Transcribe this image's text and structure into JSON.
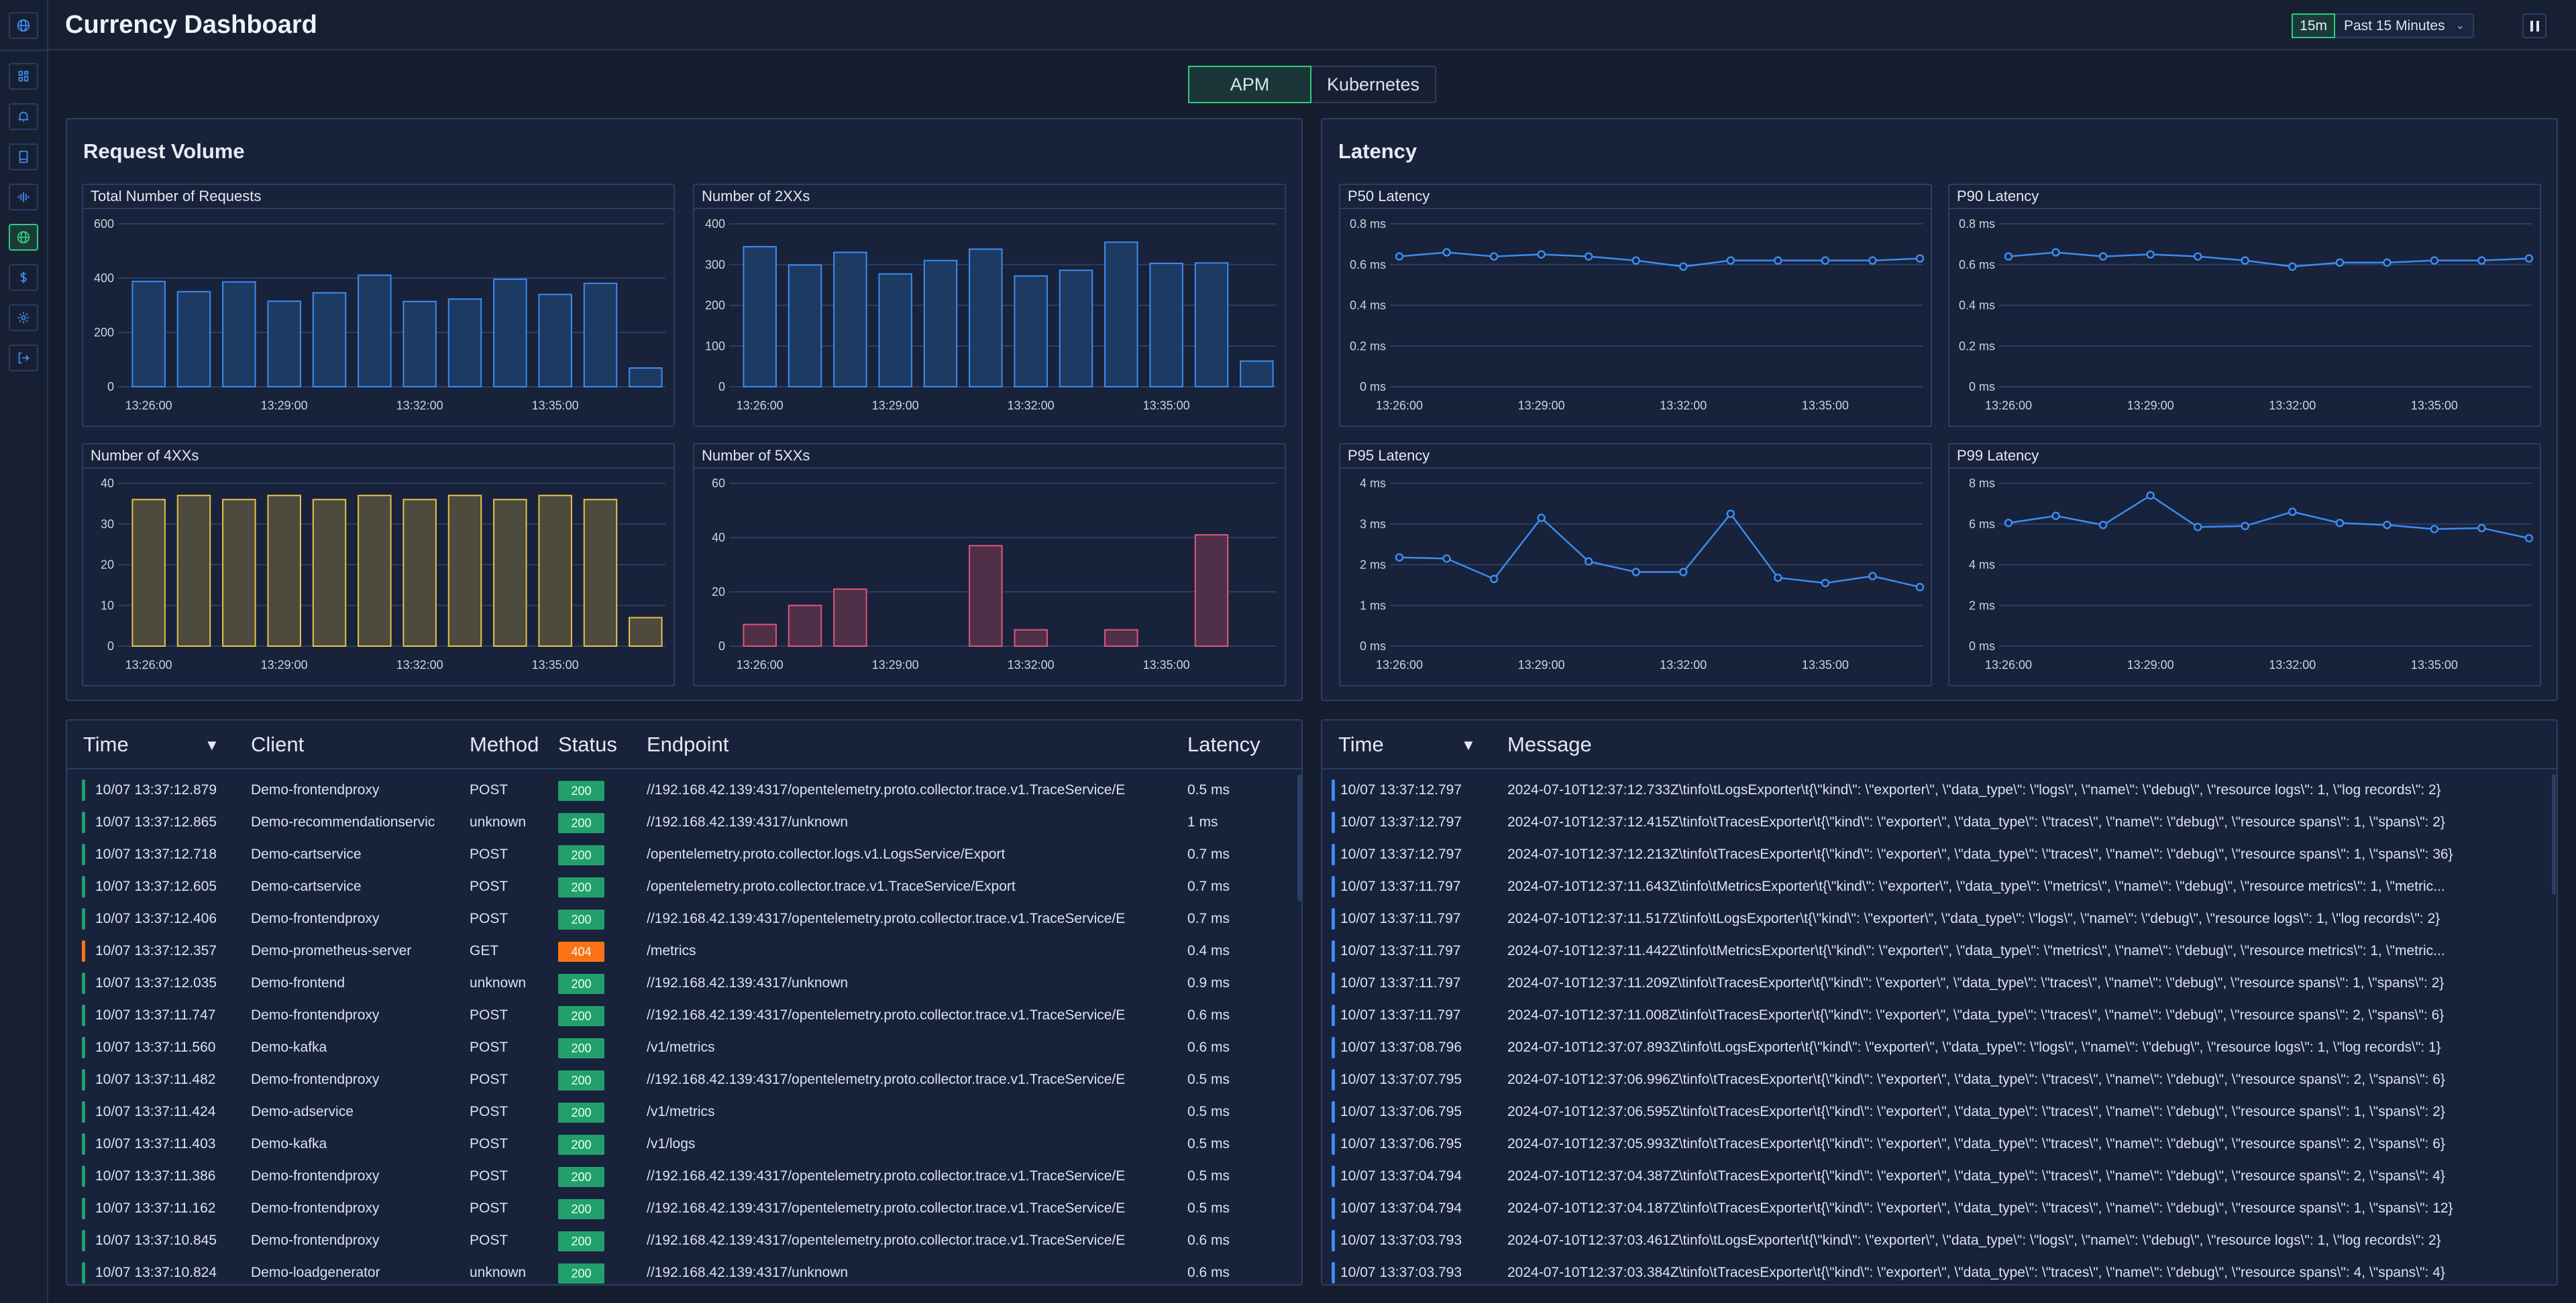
{
  "header": {
    "title": "Currency Dashboard",
    "range_short": "15m",
    "range_label": "Past 15 Minutes"
  },
  "sidebar": {
    "items": [
      {
        "icon": "globe-icon"
      },
      {
        "icon": "dashboard-grid-icon"
      },
      {
        "icon": "bell-icon"
      },
      {
        "icon": "book-icon"
      },
      {
        "icon": "waveform-icon"
      },
      {
        "icon": "globe-icon",
        "active": true
      },
      {
        "icon": "dollar-icon"
      },
      {
        "icon": "gear-icon"
      },
      {
        "icon": "logout-icon"
      }
    ]
  },
  "tabs": [
    {
      "label": "APM",
      "active": true
    },
    {
      "label": "Kubernetes",
      "active": false
    }
  ],
  "panels": {
    "request_volume": "Request Volume",
    "latency": "Latency"
  },
  "colors": {
    "accent": "#2ecc7a",
    "blue": "#3b8cf0",
    "yellow": "#e8c24a",
    "pink": "#e0557a",
    "ok": "#22a06b",
    "warn": "#f97316"
  },
  "chart_data": [
    {
      "type": "bar",
      "title": "Total Number of Requests",
      "color": "#3b8cf0",
      "fill": "#1d3a63",
      "x": [
        "13:26:00",
        "13:27:00",
        "13:28:00",
        "13:29:00",
        "13:30:00",
        "13:31:00",
        "13:32:00",
        "13:33:00",
        "13:34:00",
        "13:35:00",
        "13:36:00",
        "13:37:00"
      ],
      "x_ticks": [
        "13:26:00",
        "13:29:00",
        "13:32:00",
        "13:35:00"
      ],
      "values": [
        388,
        350,
        386,
        315,
        346,
        411,
        314,
        323,
        396,
        340,
        381,
        69
      ],
      "ylim": [
        0,
        600
      ],
      "y_ticks": [
        "0",
        "200",
        "400",
        "600"
      ],
      "grid": true
    },
    {
      "type": "bar",
      "title": "Number of 2XXs",
      "color": "#3b8cf0",
      "fill": "#1d3a63",
      "x": [
        "13:26:00",
        "13:27:00",
        "13:28:00",
        "13:29:00",
        "13:30:00",
        "13:31:00",
        "13:32:00",
        "13:33:00",
        "13:34:00",
        "13:35:00",
        "13:36:00",
        "13:37:00"
      ],
      "x_ticks": [
        "13:26:00",
        "13:29:00",
        "13:32:00",
        "13:35:00"
      ],
      "values": [
        344,
        299,
        330,
        277,
        310,
        338,
        272,
        286,
        355,
        303,
        304,
        63
      ],
      "ylim": [
        0,
        400
      ],
      "y_ticks": [
        "0",
        "100",
        "200",
        "300",
        "400"
      ],
      "grid": true
    },
    {
      "type": "bar",
      "title": "Number of 4XXs",
      "color": "#e8c24a",
      "fill": "#4d4a3e",
      "x": [
        "13:26:00",
        "13:27:00",
        "13:28:00",
        "13:29:00",
        "13:30:00",
        "13:31:00",
        "13:32:00",
        "13:33:00",
        "13:34:00",
        "13:35:00",
        "13:36:00",
        "13:37:00"
      ],
      "x_ticks": [
        "13:26:00",
        "13:29:00",
        "13:32:00",
        "13:35:00"
      ],
      "values": [
        36,
        37,
        36,
        37,
        36,
        37,
        36,
        37,
        36,
        37,
        36,
        7
      ],
      "ylim": [
        0,
        40
      ],
      "y_ticks": [
        "0",
        "10",
        "20",
        "30",
        "40"
      ],
      "grid": true
    },
    {
      "type": "bar",
      "title": "Number of 5XXs",
      "color": "#e0557a",
      "fill": "#4f3048",
      "x": [
        "13:26:00",
        "13:27:00",
        "13:28:00",
        "13:29:00",
        "13:30:00",
        "13:31:00",
        "13:32:00",
        "13:33:00",
        "13:34:00",
        "13:35:00",
        "13:36:00",
        "13:37:00"
      ],
      "x_ticks": [
        "13:26:00",
        "13:29:00",
        "13:32:00",
        "13:35:00"
      ],
      "values": [
        8,
        15,
        21,
        0,
        0,
        37,
        6,
        0,
        6,
        0,
        41,
        0
      ],
      "ylim": [
        0,
        60
      ],
      "y_ticks": [
        "0",
        "20",
        "40",
        "60"
      ],
      "grid": true
    },
    {
      "type": "line",
      "title": "P50 Latency",
      "color": "#3b8cf0",
      "x": [
        "13:26:00",
        "13:27:00",
        "13:28:00",
        "13:29:00",
        "13:30:00",
        "13:31:00",
        "13:32:00",
        "13:33:00",
        "13:34:00",
        "13:35:00",
        "13:36:00",
        "13:37:00"
      ],
      "x_ticks": [
        "13:26:00",
        "13:29:00",
        "13:32:00",
        "13:35:00"
      ],
      "values": [
        0.64,
        0.66,
        0.64,
        0.65,
        0.64,
        0.62,
        0.59,
        0.62,
        0.62,
        0.62,
        0.62,
        0.63
      ],
      "ylim": [
        0,
        0.8
      ],
      "y_ticks": [
        "0 ms",
        "0.2 ms",
        "0.4 ms",
        "0.6 ms",
        "0.8 ms"
      ],
      "unit": "ms",
      "grid": true
    },
    {
      "type": "line",
      "title": "P90 Latency",
      "color": "#3b8cf0",
      "x": [
        "13:26:00",
        "13:27:00",
        "13:28:00",
        "13:29:00",
        "13:30:00",
        "13:31:00",
        "13:32:00",
        "13:33:00",
        "13:34:00",
        "13:35:00",
        "13:36:00",
        "13:37:00"
      ],
      "x_ticks": [
        "13:26:00",
        "13:29:00",
        "13:32:00",
        "13:35:00"
      ],
      "values": [
        0.64,
        0.66,
        0.64,
        0.65,
        0.64,
        0.62,
        0.59,
        0.61,
        0.61,
        0.62,
        0.62,
        0.63
      ],
      "ylim": [
        0,
        0.8
      ],
      "y_ticks": [
        "0 ms",
        "0.2 ms",
        "0.4 ms",
        "0.6 ms",
        "0.8 ms"
      ],
      "unit": "ms",
      "grid": true
    },
    {
      "type": "line",
      "title": "P95 Latency",
      "color": "#3b8cf0",
      "x": [
        "13:26:00",
        "13:27:00",
        "13:28:00",
        "13:29:00",
        "13:30:00",
        "13:31:00",
        "13:32:00",
        "13:33:00",
        "13:34:00",
        "13:35:00",
        "13:36:00",
        "13:37:00"
      ],
      "x_ticks": [
        "13:26:00",
        "13:29:00",
        "13:32:00",
        "13:35:00"
      ],
      "values": [
        2.18,
        2.15,
        1.65,
        3.15,
        2.08,
        1.82,
        1.82,
        3.25,
        1.68,
        1.55,
        1.72,
        1.45
      ],
      "ylim": [
        0,
        4
      ],
      "y_ticks": [
        "0 ms",
        "1 ms",
        "2 ms",
        "3 ms",
        "4 ms"
      ],
      "unit": "ms",
      "grid": true
    },
    {
      "type": "line",
      "title": "P99 Latency",
      "color": "#3b8cf0",
      "x": [
        "13:26:00",
        "13:27:00",
        "13:28:00",
        "13:29:00",
        "13:30:00",
        "13:31:00",
        "13:32:00",
        "13:33:00",
        "13:34:00",
        "13:35:00",
        "13:36:00",
        "13:37:00"
      ],
      "x_ticks": [
        "13:26:00",
        "13:29:00",
        "13:32:00",
        "13:35:00"
      ],
      "values": [
        6.05,
        6.4,
        5.95,
        7.4,
        5.85,
        5.9,
        6.6,
        6.05,
        5.95,
        5.75,
        5.8,
        5.3
      ],
      "ylim": [
        0,
        8
      ],
      "y_ticks": [
        "0 ms",
        "2 ms",
        "4 ms",
        "6 ms",
        "8 ms"
      ],
      "unit": "ms",
      "grid": true
    }
  ],
  "requests": {
    "columns": {
      "time": "Time",
      "client": "Client",
      "method": "Method",
      "status": "Status",
      "endpoint": "Endpoint",
      "latency": "Latency"
    },
    "sort_icon": "sort-down-icon",
    "rows": [
      {
        "time": "10/07 13:37:12.879",
        "client": "Demo-frontendproxy",
        "method": "POST",
        "status": "200",
        "endpoint": "//192.168.42.139:4317/opentelemetry.proto.collector.trace.v1.TraceService/E",
        "latency": "0.5 ms"
      },
      {
        "time": "10/07 13:37:12.865",
        "client": "Demo-recommendationservic",
        "method": "unknown",
        "status": "200",
        "endpoint": "//192.168.42.139:4317/unknown",
        "latency": "1 ms"
      },
      {
        "time": "10/07 13:37:12.718",
        "client": "Demo-cartservice",
        "method": "POST",
        "status": "200",
        "endpoint": "/opentelemetry.proto.collector.logs.v1.LogsService/Export",
        "latency": "0.7 ms"
      },
      {
        "time": "10/07 13:37:12.605",
        "client": "Demo-cartservice",
        "method": "POST",
        "status": "200",
        "endpoint": "/opentelemetry.proto.collector.trace.v1.TraceService/Export",
        "latency": "0.7 ms"
      },
      {
        "time": "10/07 13:37:12.406",
        "client": "Demo-frontendproxy",
        "method": "POST",
        "status": "200",
        "endpoint": "//192.168.42.139:4317/opentelemetry.proto.collector.trace.v1.TraceService/E",
        "latency": "0.7 ms"
      },
      {
        "time": "10/07 13:37:12.357",
        "client": "Demo-prometheus-server",
        "method": "GET",
        "status": "404",
        "endpoint": "/metrics",
        "latency": "0.4 ms"
      },
      {
        "time": "10/07 13:37:12.035",
        "client": "Demo-frontend",
        "method": "unknown",
        "status": "200",
        "endpoint": "//192.168.42.139:4317/unknown",
        "latency": "0.9 ms"
      },
      {
        "time": "10/07 13:37:11.747",
        "client": "Demo-frontendproxy",
        "method": "POST",
        "status": "200",
        "endpoint": "//192.168.42.139:4317/opentelemetry.proto.collector.trace.v1.TraceService/E",
        "latency": "0.6 ms"
      },
      {
        "time": "10/07 13:37:11.560",
        "client": "Demo-kafka",
        "method": "POST",
        "status": "200",
        "endpoint": "/v1/metrics",
        "latency": "0.6 ms"
      },
      {
        "time": "10/07 13:37:11.482",
        "client": "Demo-frontendproxy",
        "method": "POST",
        "status": "200",
        "endpoint": "//192.168.42.139:4317/opentelemetry.proto.collector.trace.v1.TraceService/E",
        "latency": "0.5 ms"
      },
      {
        "time": "10/07 13:37:11.424",
        "client": "Demo-adservice",
        "method": "POST",
        "status": "200",
        "endpoint": "/v1/metrics",
        "latency": "0.5 ms"
      },
      {
        "time": "10/07 13:37:11.403",
        "client": "Demo-kafka",
        "method": "POST",
        "status": "200",
        "endpoint": "/v1/logs",
        "latency": "0.5 ms"
      },
      {
        "time": "10/07 13:37:11.386",
        "client": "Demo-frontendproxy",
        "method": "POST",
        "status": "200",
        "endpoint": "//192.168.42.139:4317/opentelemetry.proto.collector.trace.v1.TraceService/E",
        "latency": "0.5 ms"
      },
      {
        "time": "10/07 13:37:11.162",
        "client": "Demo-frontendproxy",
        "method": "POST",
        "status": "200",
        "endpoint": "//192.168.42.139:4317/opentelemetry.proto.collector.trace.v1.TraceService/E",
        "latency": "0.5 ms"
      },
      {
        "time": "10/07 13:37:10.845",
        "client": "Demo-frontendproxy",
        "method": "POST",
        "status": "200",
        "endpoint": "//192.168.42.139:4317/opentelemetry.proto.collector.trace.v1.TraceService/E",
        "latency": "0.6 ms"
      },
      {
        "time": "10/07 13:37:10.824",
        "client": "Demo-loadgenerator",
        "method": "unknown",
        "status": "200",
        "endpoint": "//192.168.42.139:4317/unknown",
        "latency": "0.6 ms"
      }
    ]
  },
  "logs": {
    "columns": {
      "time": "Time",
      "message": "Message"
    },
    "rows": [
      {
        "time": "10/07 13:37:12.797",
        "message": "2024-07-10T12:37:12.733Z\\tinfo\\tLogsExporter\\t{\\\"kind\\\": \\\"exporter\\\", \\\"data_type\\\": \\\"logs\\\", \\\"name\\\": \\\"debug\\\", \\\"resource logs\\\": 1, \\\"log records\\\": 2}"
      },
      {
        "time": "10/07 13:37:12.797",
        "message": "2024-07-10T12:37:12.415Z\\tinfo\\tTracesExporter\\t{\\\"kind\\\": \\\"exporter\\\", \\\"data_type\\\": \\\"traces\\\", \\\"name\\\": \\\"debug\\\", \\\"resource spans\\\": 1, \\\"spans\\\": 2}"
      },
      {
        "time": "10/07 13:37:12.797",
        "message": "2024-07-10T12:37:12.213Z\\tinfo\\tTracesExporter\\t{\\\"kind\\\": \\\"exporter\\\", \\\"data_type\\\": \\\"traces\\\", \\\"name\\\": \\\"debug\\\", \\\"resource spans\\\": 1, \\\"spans\\\": 36}"
      },
      {
        "time": "10/07 13:37:11.797",
        "message": "2024-07-10T12:37:11.643Z\\tinfo\\tMetricsExporter\\t{\\\"kind\\\": \\\"exporter\\\", \\\"data_type\\\": \\\"metrics\\\", \\\"name\\\": \\\"debug\\\", \\\"resource metrics\\\": 1, \\\"metric..."
      },
      {
        "time": "10/07 13:37:11.797",
        "message": "2024-07-10T12:37:11.517Z\\tinfo\\tLogsExporter\\t{\\\"kind\\\": \\\"exporter\\\", \\\"data_type\\\": \\\"logs\\\", \\\"name\\\": \\\"debug\\\", \\\"resource logs\\\": 1, \\\"log records\\\": 2}"
      },
      {
        "time": "10/07 13:37:11.797",
        "message": "2024-07-10T12:37:11.442Z\\tinfo\\tMetricsExporter\\t{\\\"kind\\\": \\\"exporter\\\", \\\"data_type\\\": \\\"metrics\\\", \\\"name\\\": \\\"debug\\\", \\\"resource metrics\\\": 1, \\\"metric..."
      },
      {
        "time": "10/07 13:37:11.797",
        "message": "2024-07-10T12:37:11.209Z\\tinfo\\tTracesExporter\\t{\\\"kind\\\": \\\"exporter\\\", \\\"data_type\\\": \\\"traces\\\", \\\"name\\\": \\\"debug\\\", \\\"resource spans\\\": 1, \\\"spans\\\": 2}"
      },
      {
        "time": "10/07 13:37:11.797",
        "message": "2024-07-10T12:37:11.008Z\\tinfo\\tTracesExporter\\t{\\\"kind\\\": \\\"exporter\\\", \\\"data_type\\\": \\\"traces\\\", \\\"name\\\": \\\"debug\\\", \\\"resource spans\\\": 2, \\\"spans\\\": 6}"
      },
      {
        "time": "10/07 13:37:08.796",
        "message": "2024-07-10T12:37:07.893Z\\tinfo\\tLogsExporter\\t{\\\"kind\\\": \\\"exporter\\\", \\\"data_type\\\": \\\"logs\\\", \\\"name\\\": \\\"debug\\\", \\\"resource logs\\\": 1, \\\"log records\\\": 1}"
      },
      {
        "time": "10/07 13:37:07.795",
        "message": "2024-07-10T12:37:06.996Z\\tinfo\\tTracesExporter\\t{\\\"kind\\\": \\\"exporter\\\", \\\"data_type\\\": \\\"traces\\\", \\\"name\\\": \\\"debug\\\", \\\"resource spans\\\": 2, \\\"spans\\\": 6}"
      },
      {
        "time": "10/07 13:37:06.795",
        "message": "2024-07-10T12:37:06.595Z\\tinfo\\tTracesExporter\\t{\\\"kind\\\": \\\"exporter\\\", \\\"data_type\\\": \\\"traces\\\", \\\"name\\\": \\\"debug\\\", \\\"resource spans\\\": 1, \\\"spans\\\": 2}"
      },
      {
        "time": "10/07 13:37:06.795",
        "message": "2024-07-10T12:37:05.993Z\\tinfo\\tTracesExporter\\t{\\\"kind\\\": \\\"exporter\\\", \\\"data_type\\\": \\\"traces\\\", \\\"name\\\": \\\"debug\\\", \\\"resource spans\\\": 2, \\\"spans\\\": 6}"
      },
      {
        "time": "10/07 13:37:04.794",
        "message": "2024-07-10T12:37:04.387Z\\tinfo\\tTracesExporter\\t{\\\"kind\\\": \\\"exporter\\\", \\\"data_type\\\": \\\"traces\\\", \\\"name\\\": \\\"debug\\\", \\\"resource spans\\\": 2, \\\"spans\\\": 4}"
      },
      {
        "time": "10/07 13:37:04.794",
        "message": "2024-07-10T12:37:04.187Z\\tinfo\\tTracesExporter\\t{\\\"kind\\\": \\\"exporter\\\", \\\"data_type\\\": \\\"traces\\\", \\\"name\\\": \\\"debug\\\", \\\"resource spans\\\": 1, \\\"spans\\\": 12}"
      },
      {
        "time": "10/07 13:37:03.793",
        "message": "2024-07-10T12:37:03.461Z\\tinfo\\tLogsExporter\\t{\\\"kind\\\": \\\"exporter\\\", \\\"data_type\\\": \\\"logs\\\", \\\"name\\\": \\\"debug\\\", \\\"resource logs\\\": 1, \\\"log records\\\": 2}"
      },
      {
        "time": "10/07 13:37:03.793",
        "message": "2024-07-10T12:37:03.384Z\\tinfo\\tTracesExporter\\t{\\\"kind\\\": \\\"exporter\\\", \\\"data_type\\\": \\\"traces\\\", \\\"name\\\": \\\"debug\\\", \\\"resource spans\\\": 4, \\\"spans\\\": 4}"
      }
    ]
  }
}
